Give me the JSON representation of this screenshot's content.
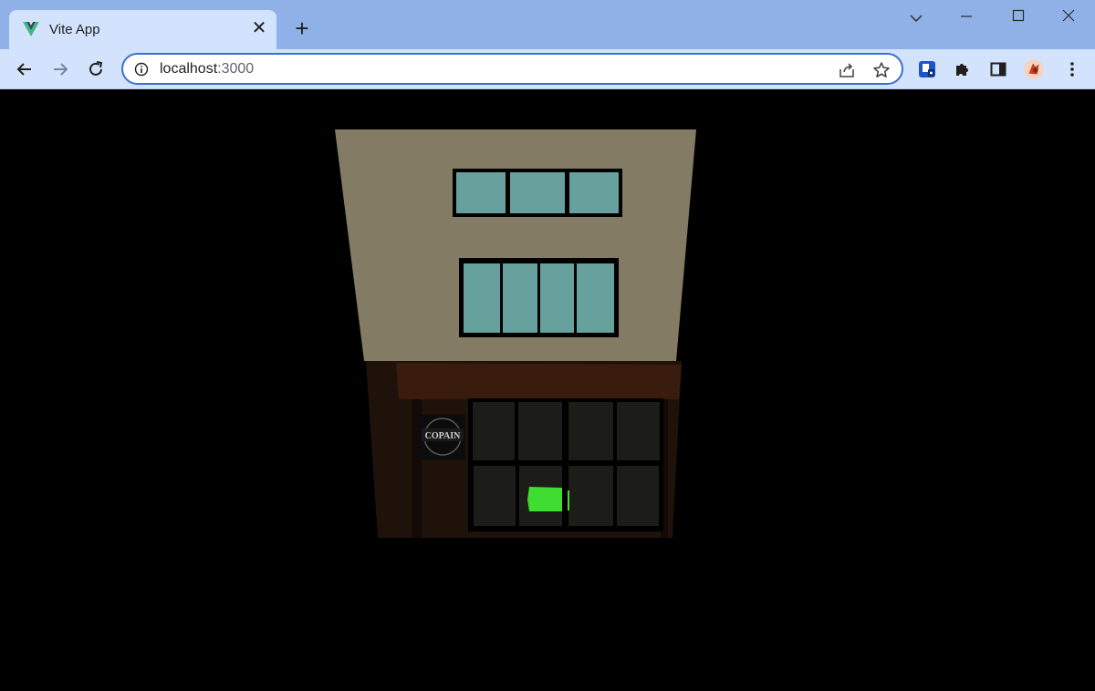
{
  "browser": {
    "tab_title": "Vite App",
    "tab_close_glyph": "✕",
    "new_tab_glyph": "+",
    "url_host": "localhost",
    "url_port": ":3000",
    "icons": {
      "favicon": "vite-logo-icon",
      "back": "back-arrow-icon",
      "forward": "forward-arrow-icon",
      "reload": "reload-icon",
      "info": "info-icon",
      "share": "share-icon",
      "bookmark": "star-icon",
      "extension": "extension-icon",
      "puzzle": "puzzle-icon",
      "sidepanel": "side-panel-icon",
      "profile": "profile-avatar",
      "menu": "kebab-menu-icon"
    },
    "colors": {
      "titlebar": "#8fb1e8",
      "toolbar": "#d3e3fd",
      "omnibox_border": "#3b6fd1"
    }
  },
  "scene": {
    "sign_text": "COPAIN",
    "colors": {
      "background": "#000000",
      "facade": "#847b65",
      "windows": "#66a19e",
      "awning": "#3a1c0f",
      "storefront": "#1e120b",
      "shop_window": "#1c1c18",
      "light": "#3fdc32"
    }
  }
}
